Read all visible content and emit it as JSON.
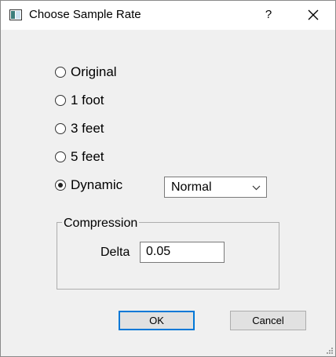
{
  "window": {
    "title": "Choose Sample Rate",
    "help_label": "?"
  },
  "sample_rate": {
    "options": [
      {
        "label": "Original",
        "checked": false
      },
      {
        "label": "1 foot",
        "checked": false
      },
      {
        "label": "3 feet",
        "checked": false
      },
      {
        "label": "5 feet",
        "checked": false
      },
      {
        "label": "Dynamic",
        "checked": true
      }
    ],
    "dynamic_mode": {
      "selected": "Normal"
    }
  },
  "compression": {
    "group_label": "Compression",
    "delta_label": "Delta",
    "delta_value": "0.05"
  },
  "buttons": {
    "ok_label": "OK",
    "cancel_label": "Cancel"
  },
  "colors": {
    "accent": "#0078d7",
    "dialog_background": "#f0f0f0",
    "titlebar_background": "#ffffff"
  },
  "icons": {
    "app": "window-app-icon",
    "close": "close-icon",
    "dropdown": "chevron-down-icon",
    "resize": "resize-grip-icon"
  }
}
